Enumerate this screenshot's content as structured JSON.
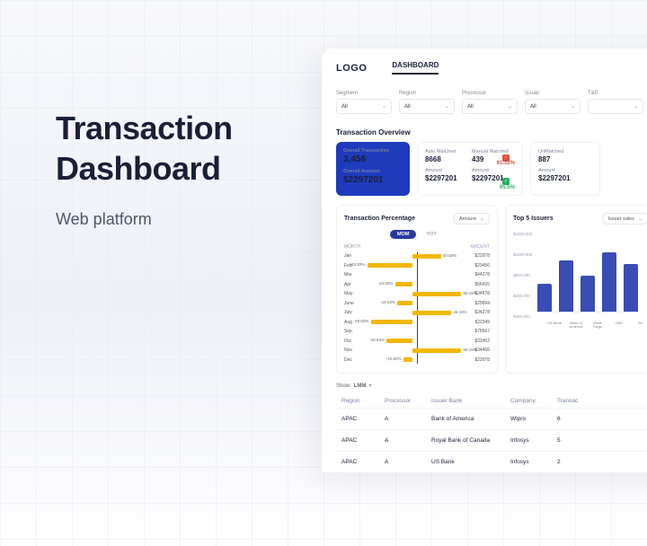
{
  "hero": {
    "title_l1": "Transaction",
    "title_l2": "Dashboard",
    "subtitle": "Web platform"
  },
  "logo": "LOGO",
  "nav": {
    "dashboard": "DASHBOARD"
  },
  "filters": [
    {
      "label": "Segment",
      "value": "All"
    },
    {
      "label": "Region",
      "value": "All"
    },
    {
      "label": "Processor",
      "value": "All"
    },
    {
      "label": "Issuer",
      "value": "All"
    },
    {
      "label": "T&E",
      "value": ""
    }
  ],
  "overview": {
    "heading": "Transaction Overview"
  },
  "cards": {
    "primary": {
      "l1": "Overall Transaction",
      "v1": "3,456",
      "l2": "Overall Amount",
      "v2": "$2297201"
    },
    "auto": {
      "l": "Auto Matched",
      "v": "8668",
      "al": "Amount",
      "av": "$2297201"
    },
    "manual": {
      "l": "Manual Matched",
      "v": "439",
      "al": "Amount",
      "av": "$2297201",
      "pct": "91.12%",
      "pct2": "95.5%"
    },
    "unmatched": {
      "l": "UnMatched",
      "v": "887",
      "al": "Amount",
      "av": "$2297201"
    }
  },
  "tp": {
    "title": "Transaction Percentage",
    "sel": "Amount",
    "toggle": {
      "a": "MOM",
      "b": "YOY"
    },
    "cols": {
      "m": "MONTH",
      "a": "AMOUNT"
    }
  },
  "issuers": {
    "title": "Top 5 Issuers",
    "sel": "Issuer sales"
  },
  "chart_data": {
    "tp": {
      "type": "bar",
      "title": "Transaction Percentage (MOM)",
      "xlabel": "%",
      "ylabel": "Month",
      "categories": [
        "Jan",
        "Feb",
        "Mar",
        "Apr",
        "May",
        "June",
        "July",
        "Aug",
        "Sep",
        "Oct",
        "Nov",
        "Dec"
      ],
      "values": [
        33.83,
        -53.83,
        null,
        -20.83,
        58.19,
        -18.03,
        46.19,
        -49.83,
        null,
        -30.83,
        58.19,
        -10.83
      ],
      "amounts": [
        "$22978",
        "$23456",
        "$44278",
        "$56435",
        "$34578",
        "$25894",
        "$34278",
        "$22345",
        "$78567",
        "$32452",
        "$34456",
        "$22978"
      ]
    },
    "issuers": {
      "type": "bar",
      "title": "Top 5 Issuers",
      "ylabel": "",
      "ylim": [
        0,
        1200000
      ],
      "yticks": [
        "$1200,000",
        "$1000,000",
        "$800,000",
        "$600,000",
        "$400,000"
      ],
      "categories": [
        "US Bank",
        "Bank of America",
        "Wells Fargo",
        "DBS",
        "Ro"
      ],
      "values": [
        420000,
        760000,
        540000,
        880000,
        700000
      ]
    }
  },
  "table": {
    "show": "Show:",
    "mode": "LMM",
    "headers": {
      "c1": "Region",
      "c2": "Processor",
      "c3": "Issuer Bank",
      "c4": "Company",
      "c5": "Transac"
    },
    "rows": [
      {
        "c1": "APAC",
        "c2": "A",
        "c3": "Bank of America",
        "c4": "Wipro",
        "c5": "6"
      },
      {
        "c1": "APAC",
        "c2": "A",
        "c3": "Royal Bank of Canada",
        "c4": "Infosys",
        "c5": "5"
      },
      {
        "c1": "APAC",
        "c2": "A",
        "c3": "US Bank",
        "c4": "Infosys",
        "c5": "2"
      }
    ]
  }
}
